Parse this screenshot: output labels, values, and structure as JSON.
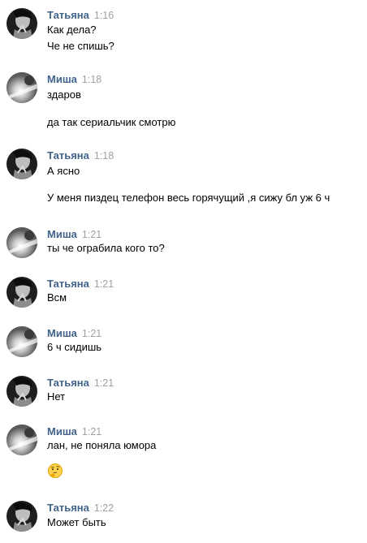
{
  "messages": [
    {
      "author": "Татьяна",
      "time": "1:16",
      "avatar": "avatar-tatiana",
      "lines": [
        "Как дела?",
        "Че не спишь?"
      ]
    },
    {
      "author": "Миша",
      "time": "1:18",
      "avatar": "avatar-misha",
      "lines": [
        "здаров",
        "да так сериальчик смотрю"
      ]
    },
    {
      "author": "Татьяна",
      "time": "1:18",
      "avatar": "avatar-tatiana",
      "lines": [
        "А ясно",
        "У меня пиздец телефон весь горячущий ,я сижу бл уж 6 ч"
      ]
    },
    {
      "author": "Миша",
      "time": "1:21",
      "avatar": "avatar-misha",
      "lines": [
        "ты че ограбила кого то?"
      ]
    },
    {
      "author": "Татьяна",
      "time": "1:21",
      "avatar": "avatar-tatiana",
      "lines": [
        "Всм"
      ]
    },
    {
      "author": "Миша",
      "time": "1:21",
      "avatar": "avatar-misha",
      "lines": [
        "6 ч сидишь"
      ]
    },
    {
      "author": "Татьяна",
      "time": "1:21",
      "avatar": "avatar-tatiana",
      "lines": [
        "Нет"
      ]
    },
    {
      "author": "Миша",
      "time": "1:21",
      "avatar": "avatar-misha",
      "lines": [
        "лан, не поняла юмора"
      ],
      "emoji": "thinking-face-emoji"
    },
    {
      "author": "Татьяна",
      "time": "1:22",
      "avatar": "avatar-tatiana",
      "lines": [
        "Может быть"
      ]
    }
  ]
}
